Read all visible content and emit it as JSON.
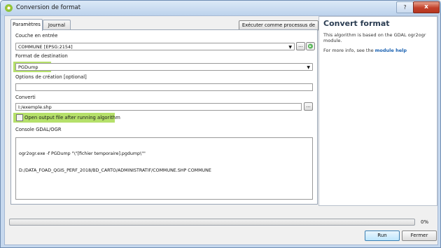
{
  "window": {
    "title": "Conversion de format",
    "help_label": "?",
    "close_label": "x"
  },
  "tabs": [
    {
      "label": "Paramètres",
      "active": true
    },
    {
      "label": "Journal",
      "active": false
    }
  ],
  "batch_button_label": "Exécuter comme processus de lot...",
  "form": {
    "input_layer_label": "Couche en entrée",
    "input_layer_value": "COMMUNE [EPSG:2154]",
    "output_format_label": "Format de destination",
    "output_format_value": "PGDump",
    "creation_options_label": "Options de création [optional]",
    "creation_options_value": "",
    "converted_label": "Converti",
    "converted_value": "I:/exemple.shp",
    "open_output_label": "Open output file after running algorithm",
    "open_output_checked": false,
    "console_label": "Console GDAL/OGR",
    "console_lines": [
      "ogr2ogr.exe -f PGDump \"\\\"[fichier temporaire].pgdump\\\"\"",
      "D:/DATA_FOAD_QGIS_PERF_2018/BD_CARTO/ADMINISTRATIF/COMMUNE.SHP COMMUNE"
    ],
    "browse_label": "..."
  },
  "help_panel": {
    "title": "Convert format",
    "text": "This algorithm is based on the GDAL ogr2ogr module.",
    "more_info_prefix": "For more info, see the",
    "more_info_link": "module help"
  },
  "progress": {
    "value": 0,
    "label": "0%"
  },
  "buttons": {
    "run": "Run",
    "close": "Fermer"
  },
  "colors": {
    "highlight": "#b5e06a",
    "accent": "#2b3d52",
    "link": "#1b62b2"
  }
}
